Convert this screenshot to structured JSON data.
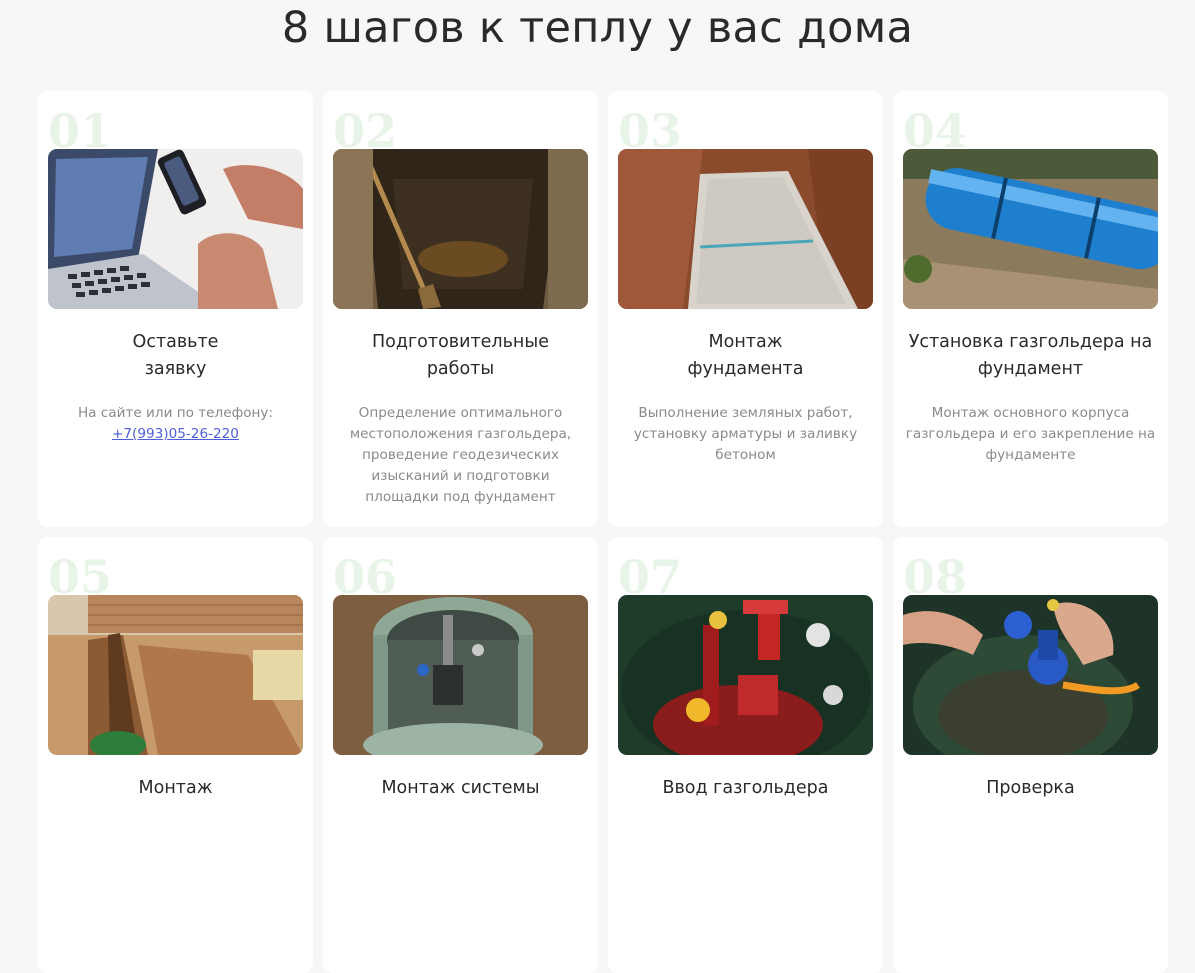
{
  "page": {
    "title": "8 шагов к теплу у вас дома"
  },
  "steps": [
    {
      "number": "01",
      "title": "Оставьте\nзаявку",
      "description": "На сайте или по телефону:",
      "link": "+7(993)05-26-220",
      "image": "laptop-phone-hands-photo"
    },
    {
      "number": "02",
      "title": "Подготовительные\nработы",
      "description": "Определение оптимального местоположения газгольдера, проведение геодезических изысканий и подготовки площадки под фундамент",
      "image": "excavated-pit-photo"
    },
    {
      "number": "03",
      "title": "Монтаж\nфундамента",
      "description": "Выполнение земляных работ, установку арматуры и заливку бетоном",
      "image": "concrete-slab-photo"
    },
    {
      "number": "04",
      "title": "Установка газгольдера на\nфундамент",
      "description": "Монтаж основного корпуса газгольдера и его закрепление на фундаменте",
      "image": "blue-tank-photo"
    },
    {
      "number": "05",
      "title": "Монтаж",
      "description": "",
      "image": "trench-photo"
    },
    {
      "number": "06",
      "title": "Монтаж системы",
      "description": "",
      "image": "tank-neck-photo"
    },
    {
      "number": "07",
      "title": "Ввод газгольдера",
      "description": "",
      "image": "red-valves-photo"
    },
    {
      "number": "08",
      "title": "Проверка",
      "description": "",
      "image": "blue-regulator-photo"
    }
  ],
  "colors": {
    "background": "#f7f7f7",
    "card": "#ffffff",
    "number": "#e9f4e8",
    "link": "#4d5fd6",
    "description": "#8a8a8a"
  }
}
